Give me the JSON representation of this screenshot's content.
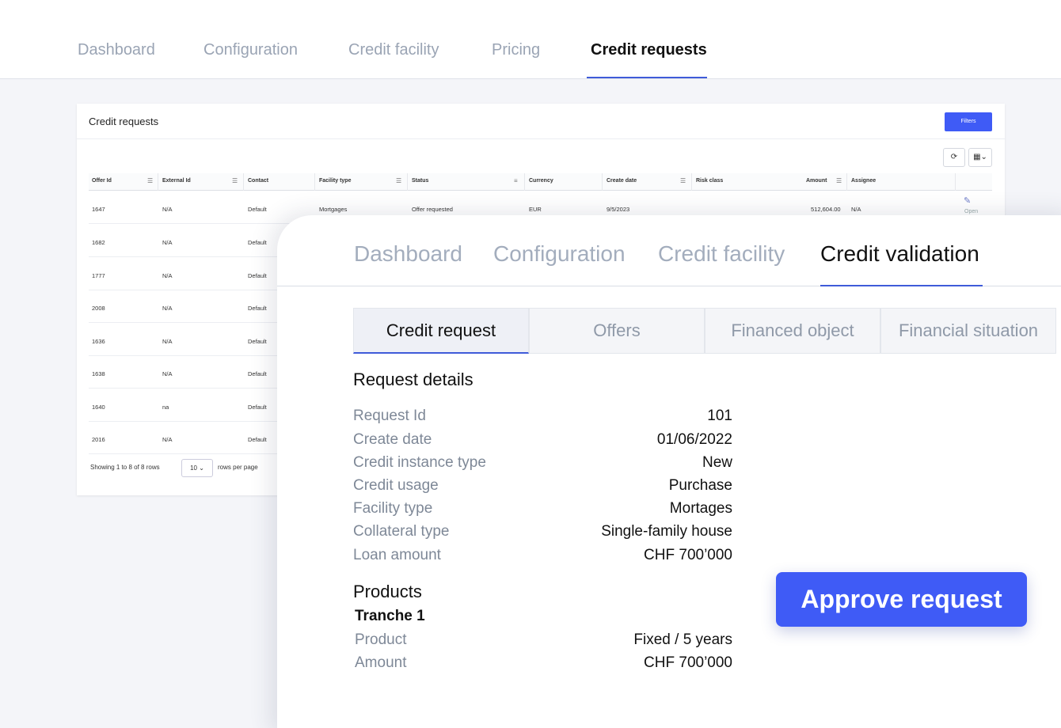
{
  "bg_nav": {
    "tabs": [
      "Dashboard",
      "Configuration",
      "Credit facility",
      "Pricing",
      "Credit requests"
    ],
    "active": "Credit requests"
  },
  "bg_card": {
    "title": "Credit requests",
    "filter_label": "Filters",
    "columns": [
      "Offer Id",
      "External Id",
      "Contact",
      "Facility type",
      "Status",
      "Currency",
      "Create date",
      "Risk class",
      "Amount",
      "Assignee"
    ],
    "rows": [
      {
        "offer_id": "1647",
        "external_id": "N/A",
        "contact": "Default",
        "facility_type": "Mortgages",
        "status": "Offer requested",
        "currency": "EUR",
        "create_date": "9/5/2023",
        "amount": "512,604.00",
        "assignee": "N/A",
        "action": "Open"
      },
      {
        "offer_id": "1682",
        "external_id": "N/A",
        "contact": "Default"
      },
      {
        "offer_id": "1777",
        "external_id": "N/A",
        "contact": "Default"
      },
      {
        "offer_id": "2008",
        "external_id": "N/A",
        "contact": "Default"
      },
      {
        "offer_id": "1636",
        "external_id": "N/A",
        "contact": "Default"
      },
      {
        "offer_id": "1638",
        "external_id": "N/A",
        "contact": "Default"
      },
      {
        "offer_id": "1640",
        "external_id": "na",
        "contact": "Default"
      },
      {
        "offer_id": "2016",
        "external_id": "N/A",
        "contact": "Default"
      }
    ],
    "footer_showing": "Showing 1 to 8 of 8 rows",
    "page_size": "10",
    "footer_rows": "rows per page"
  },
  "panel": {
    "tabs": [
      "Dashboard",
      "Configuration",
      "Credit facility",
      "Credit validation"
    ],
    "active": "Credit validation",
    "subtabs": [
      "Credit request",
      "Offers",
      "Financed object",
      "Financial situation"
    ],
    "active_subtab": "Credit request",
    "request_details_title": "Request details",
    "details": [
      {
        "label": "Request Id",
        "value": "101"
      },
      {
        "label": "Create date",
        "value": "01/06/2022"
      },
      {
        "label": "Credit instance type",
        "value": "New"
      },
      {
        "label": "Credit usage",
        "value": "Purchase"
      },
      {
        "label": "Facility type",
        "value": "Mortages"
      },
      {
        "label": "Collateral type",
        "value": "Single-family house"
      },
      {
        "label": "Loan amount",
        "value": "CHF 700’000"
      }
    ],
    "products_title": "Products",
    "tranche_title": "Tranche 1",
    "products": [
      {
        "label": "Product",
        "value": "Fixed / 5 years"
      },
      {
        "label": "Amount",
        "value": "CHF 700’000"
      }
    ],
    "approve_label": "Approve request"
  },
  "colors": {
    "accent": "#3f5bf6",
    "underline": "#3f5bd9",
    "muted_text": "#9aa4b4"
  }
}
